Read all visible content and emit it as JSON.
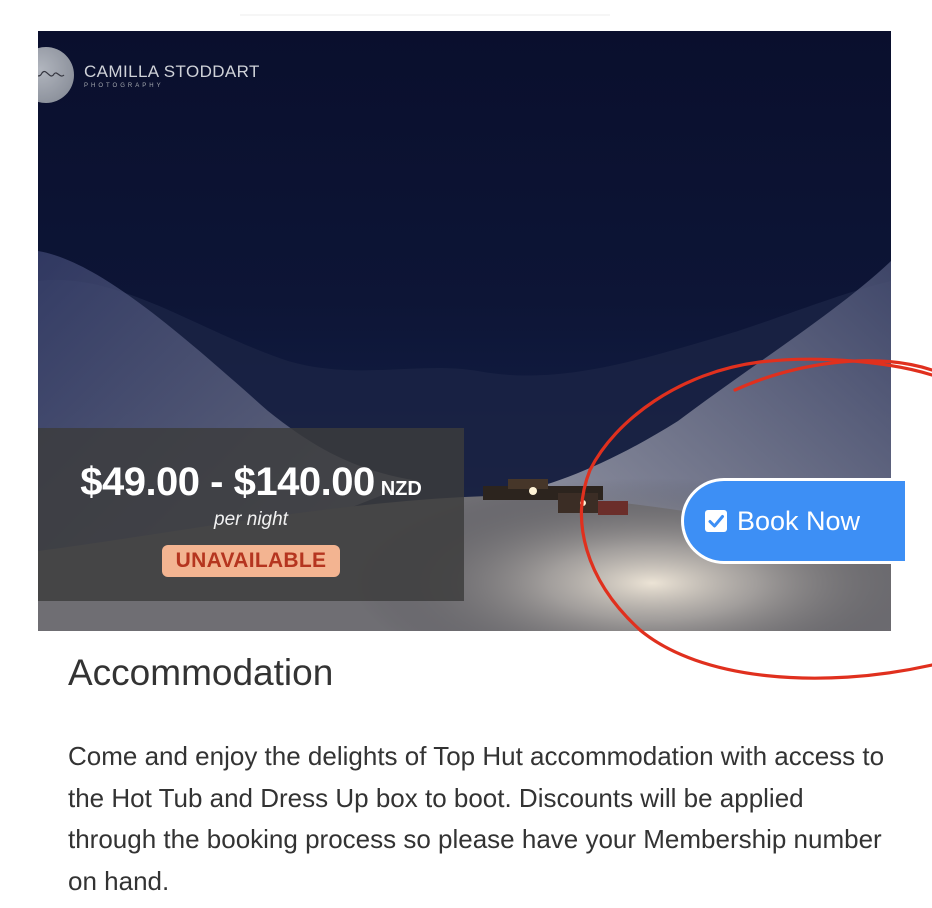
{
  "watermark": {
    "name": "CAMILLA STODDART",
    "subtitle": "PHOTOGRAPHY"
  },
  "pricing": {
    "range": "$49.00 - $140.00",
    "currency": "NZD",
    "period": "per night",
    "status": "UNAVAILABLE"
  },
  "book_button": {
    "label": "Book Now",
    "icon": "checkbox-checked-icon"
  },
  "section": {
    "title": "Accommodation",
    "description": "Come and enjoy the delights of Top Hut accommodation with access to the Hot Tub and Dress Up box to boot. Discounts will be applied through the booking process so please have your Membership number on hand."
  },
  "colors": {
    "button": "#3d8ff5",
    "badge_bg": "#f3b491",
    "badge_text": "#b5351f",
    "annotation": "#e0301e",
    "sky": "#0d1536"
  },
  "hero_image": {
    "subject": "night-mountain-hut-scene"
  }
}
